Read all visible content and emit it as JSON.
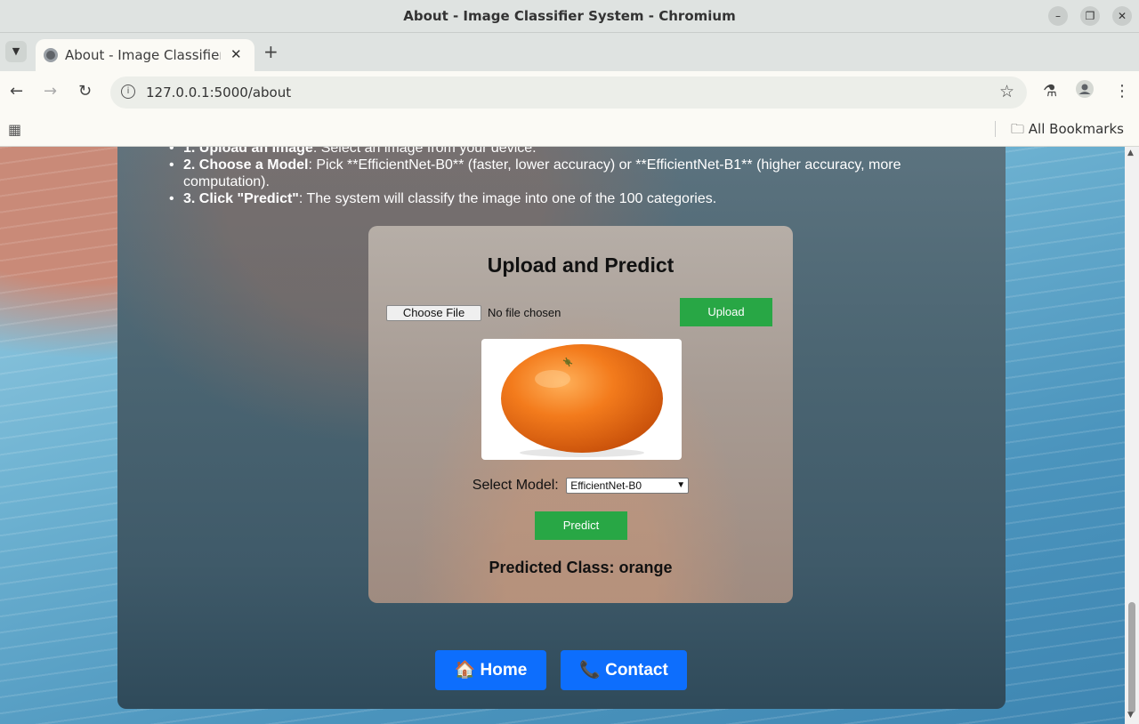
{
  "window": {
    "title": "About - Image Classifier System - Chromium"
  },
  "tab": {
    "title": "About - Image Classifier System",
    "close": "✕",
    "new_tab": "+"
  },
  "address_bar": {
    "url": "127.0.0.1:5000/about"
  },
  "bookmarks_bar": {
    "folder_label": "All Bookmarks"
  },
  "page": {
    "steps": [
      {
        "label": "1. Upload an Image",
        "text": ": Select an image from your device."
      },
      {
        "label": "2. Choose a Model",
        "text": ": Pick **EfficientNet-B0** (faster, lower accuracy) or **EfficientNet-B1** (higher accuracy, more computation)."
      },
      {
        "label": "3. Click \"Predict\"",
        "text": ": The system will classify the image into one of the 100 categories."
      }
    ],
    "card": {
      "title": "Upload and Predict",
      "choose_file_label": "Choose File",
      "file_status": "No file chosen",
      "upload_label": "Upload",
      "model_label": "Select Model:",
      "model_selected": "EfficientNet-B0",
      "predict_label": "Predict",
      "result_text": "Predicted Class: orange"
    },
    "nav": {
      "home_label": "🏠 Home",
      "contact_label": "📞 Contact"
    }
  },
  "colors": {
    "button_green": "#28a745",
    "nav_blue": "#0d6efd",
    "orange_fruit": "#f07a1e"
  },
  "icons": [
    "tab-list-icon",
    "browser-favicon",
    "back-icon",
    "forward-icon",
    "reload-icon",
    "site-info-icon",
    "bookmark-star-icon",
    "labs-flask-icon",
    "profile-icon",
    "menu-kebab-icon",
    "apps-grid-icon",
    "folder-icon",
    "minimize-icon",
    "restore-icon",
    "close-icon"
  ]
}
